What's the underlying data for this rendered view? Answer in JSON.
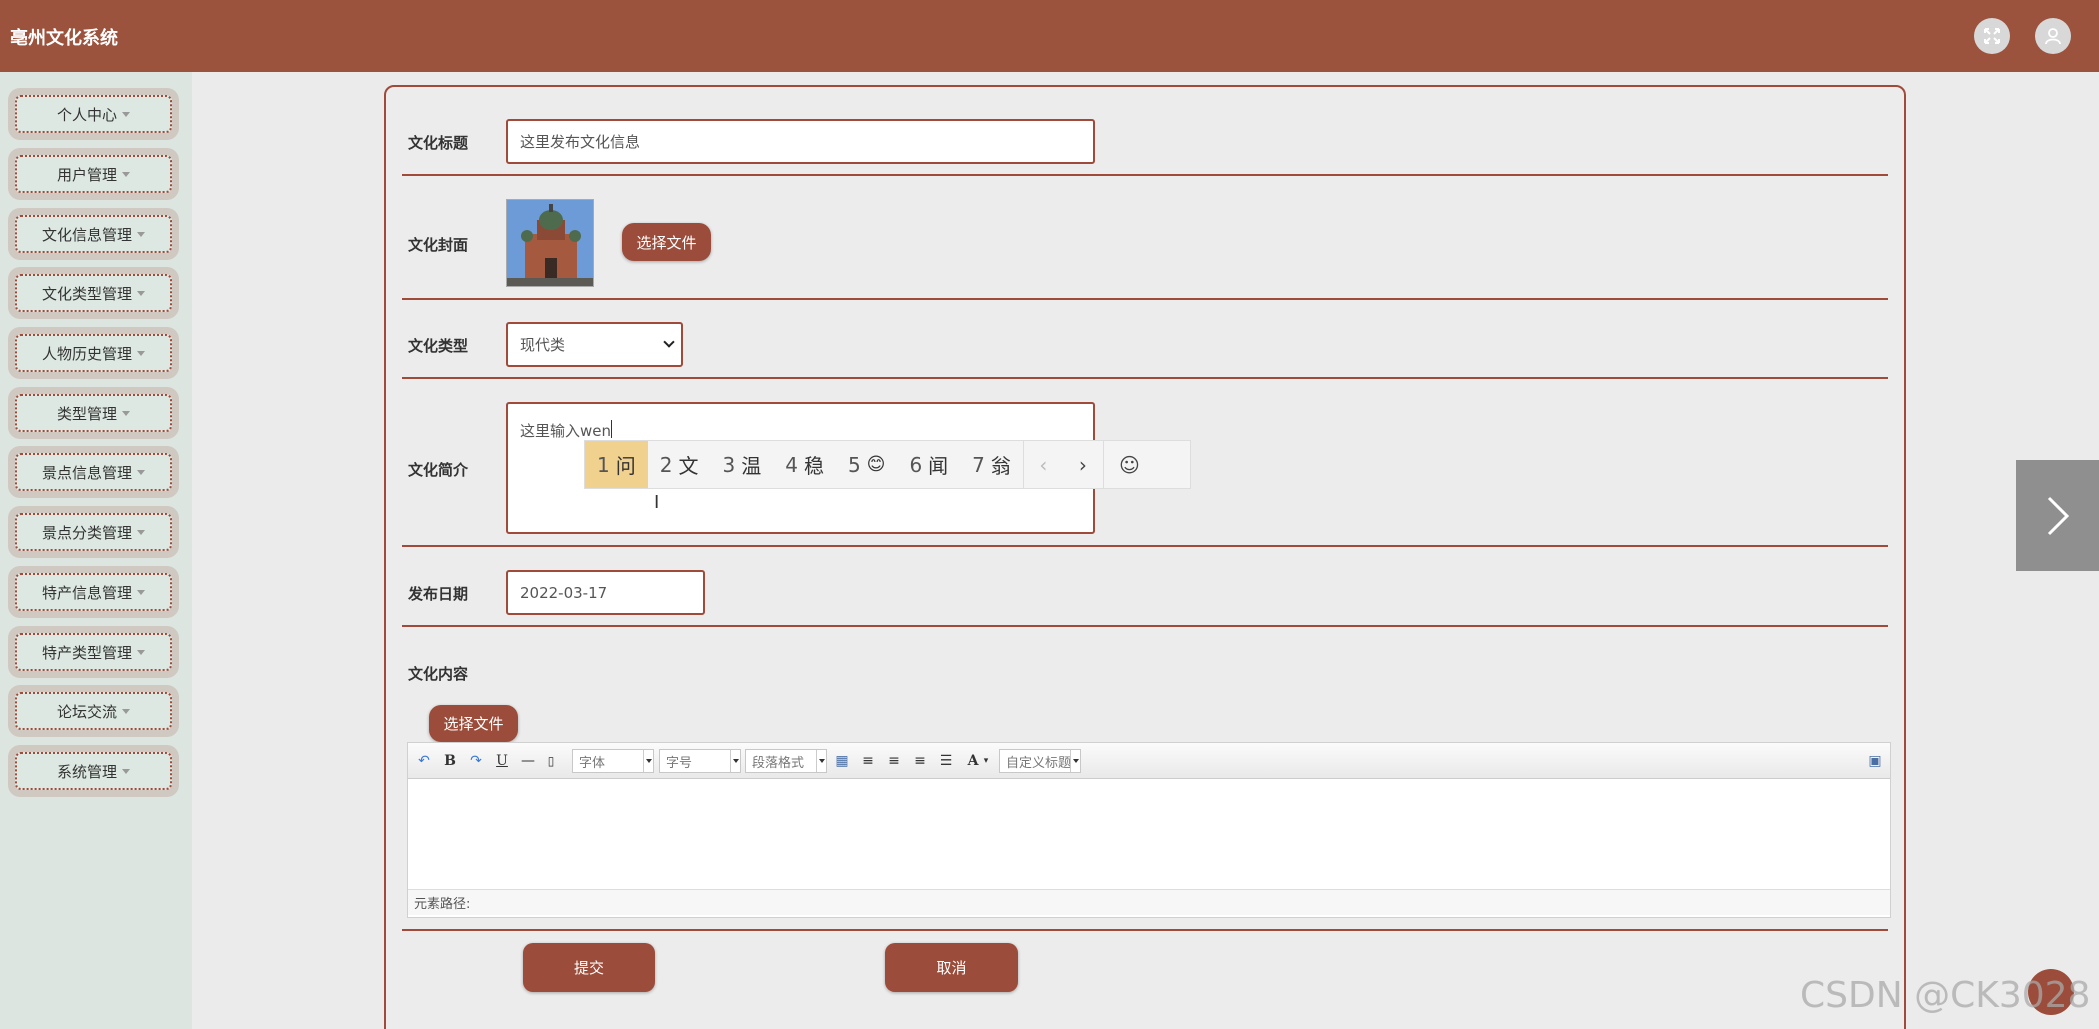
{
  "header": {
    "title": "亳州文化系统",
    "icons": [
      "fullscreen-icon",
      "user-icon"
    ]
  },
  "sidebar": {
    "items": [
      {
        "label": "个人中心"
      },
      {
        "label": "用户管理"
      },
      {
        "label": "文化信息管理"
      },
      {
        "label": "文化类型管理"
      },
      {
        "label": "人物历史管理"
      },
      {
        "label": "类型管理"
      },
      {
        "label": "景点信息管理"
      },
      {
        "label": "景点分类管理"
      },
      {
        "label": "特产信息管理"
      },
      {
        "label": "特产类型管理"
      },
      {
        "label": "论坛交流"
      },
      {
        "label": "系统管理"
      }
    ]
  },
  "form": {
    "title_label": "文化标题",
    "title_value": "这里发布文化信息",
    "cover_label": "文化封面",
    "cover_button": "选择文件",
    "type_label": "文化类型",
    "type_value": "现代类",
    "intro_label": "文化简介",
    "intro_value": "这里输入wen",
    "date_label": "发布日期",
    "date_value": "2022-03-17",
    "content_label": "文化内容",
    "content_button": "选择文件",
    "submit_label": "提交",
    "cancel_label": "取消"
  },
  "ime": {
    "candidates": [
      {
        "num": "1",
        "text": "问"
      },
      {
        "num": "2",
        "text": "文"
      },
      {
        "num": "3",
        "text": "温"
      },
      {
        "num": "4",
        "text": "稳"
      },
      {
        "num": "5",
        "text": "😊"
      },
      {
        "num": "6",
        "text": "闻"
      },
      {
        "num": "7",
        "text": "翁"
      }
    ],
    "selected_index": 0
  },
  "editor": {
    "font_label": "字体",
    "size_label": "字号",
    "paragraph_label": "段落格式",
    "custom_title_label": "自定义标题",
    "bold_label": "B",
    "underline_label": "U",
    "font_color_label": "A",
    "footer_label": "元素路径:"
  },
  "watermark": "CSDN @CK3028"
}
